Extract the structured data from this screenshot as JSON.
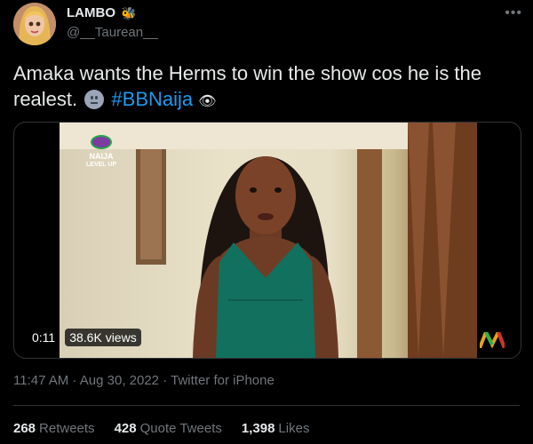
{
  "user": {
    "display_name": "LAMBO",
    "badge_emoji": "🐝",
    "handle": "@__Taurean__"
  },
  "tweet": {
    "text": "Amaka wants the Herms to win the show cos he is the realest.",
    "hashtag": "#BBNaija",
    "hashtag_emoji": "👁"
  },
  "video": {
    "duration": "0:11",
    "views": "38.6K views",
    "overlay_brand": "NAIJA",
    "overlay_sub": "LEVEL UP"
  },
  "meta": {
    "time": "11:47 AM",
    "date": "Aug 30, 2022",
    "source": "Twitter for iPhone"
  },
  "stats": {
    "retweets_count": "268",
    "retweets_label": "Retweets",
    "quotes_count": "428",
    "quotes_label": "Quote Tweets",
    "likes_count": "1,398",
    "likes_label": "Likes"
  },
  "colors": {
    "link": "#1d9bf0",
    "muted": "#71767b",
    "background": "#000000"
  }
}
